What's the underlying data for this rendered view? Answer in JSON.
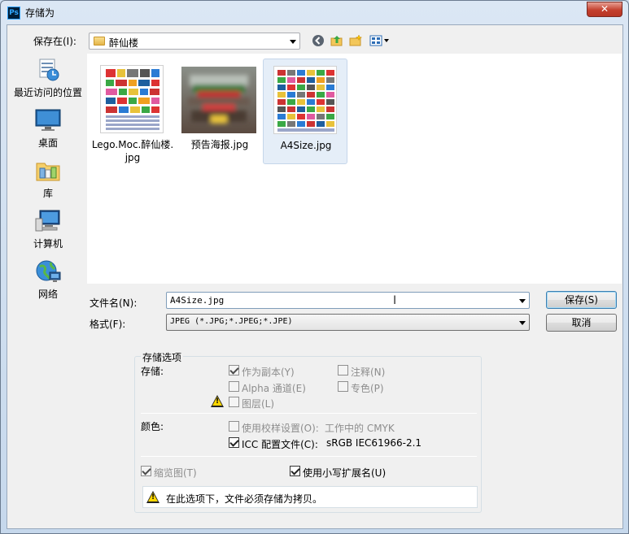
{
  "window": {
    "title": "存储为",
    "app_icon": "Ps",
    "close_glyph": "✕"
  },
  "save_in": {
    "label": "保存在(I):",
    "value": "醉仙楼"
  },
  "toolbar": {
    "back": "back-icon",
    "up": "up-folder-icon",
    "new_folder": "new-folder-icon",
    "view": "view-menu-icon"
  },
  "places": [
    {
      "label": "最近访问的位置",
      "icon": "recent-places-icon"
    },
    {
      "label": "桌面",
      "icon": "desktop-icon"
    },
    {
      "label": "库",
      "icon": "libraries-icon"
    },
    {
      "label": "计算机",
      "icon": "computer-icon"
    },
    {
      "label": "网络",
      "icon": "network-icon"
    }
  ],
  "files": [
    {
      "name": "Lego.Moc.醉仙楼.jpg",
      "name_line1": "Lego.Moc.醉仙楼.",
      "name_line2": "jpg",
      "selected": false
    },
    {
      "name": "预告海报.jpg",
      "selected": false
    },
    {
      "name": "A4Size.jpg",
      "selected": true
    }
  ],
  "filename": {
    "label": "文件名(N):",
    "value": "A4Size.jpg"
  },
  "format": {
    "label": "格式(F):",
    "value": "JPEG (*.JPG;*.JPEG;*.JPE)"
  },
  "buttons": {
    "save": "保存(S)",
    "cancel": "取消"
  },
  "options": {
    "group_title": "存储选项",
    "storage_label": "存储:",
    "as_copy": "作为副本(Y)",
    "alpha": "Alpha 通道(E)",
    "layers": "图层(L)",
    "notes": "注释(N)",
    "spot": "专色(P)",
    "color_label": "颜色:",
    "proof": "使用校样设置(O):",
    "proof_value": "工作中的 CMYK",
    "icc": "ICC 配置文件(C):",
    "icc_value": "sRGB IEC61966-2.1",
    "thumbnail": "缩览图(T)",
    "lowercase": "使用小写扩展名(U)",
    "warning": "在此选项下，文件必须存储为拷贝。"
  },
  "colors": {
    "accent": "#3c7fb1",
    "warning": "#ffd700",
    "close": "#c4402e"
  }
}
